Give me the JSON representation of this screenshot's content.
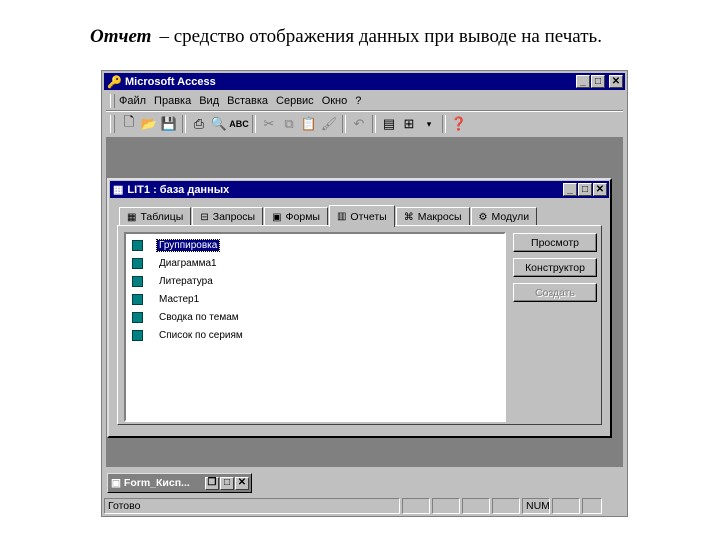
{
  "caption": {
    "term": "Отчет",
    "definition": "– средство отображения данных при выводе на печать."
  },
  "app": {
    "title": "Microsoft Access",
    "menu": [
      "Файл",
      "Правка",
      "Вид",
      "Вставка",
      "Сервис",
      "Окно",
      "?"
    ],
    "toolbar_icons": [
      "new-icon",
      "open-icon",
      "save-icon",
      "print-icon",
      "print-preview-icon",
      "spelling-icon",
      "cut-icon",
      "copy-icon",
      "paste-icon",
      "format-painter-icon",
      "undo-icon",
      "properties-icon",
      "relationships-icon",
      "new-object-icon",
      "help-icon"
    ]
  },
  "db_window": {
    "title": "LIT1 : база данных",
    "tabs": [
      {
        "label": "Таблицы",
        "icon": "table-icon"
      },
      {
        "label": "Запросы",
        "icon": "query-icon"
      },
      {
        "label": "Формы",
        "icon": "form-icon"
      },
      {
        "label": "Отчеты",
        "icon": "report-icon",
        "active": true
      },
      {
        "label": "Макросы",
        "icon": "macro-icon"
      },
      {
        "label": "Модули",
        "icon": "module-icon"
      }
    ],
    "reports": [
      "Группировка",
      "Диаграмма1",
      "Литература",
      "Мастер1",
      "Сводка по темам",
      "Список по сериям"
    ],
    "selected_index": 0,
    "buttons": {
      "preview": "Просмотр",
      "design": "Конструктор",
      "create": "Создать"
    }
  },
  "minimized_window": {
    "title": "Form_Кисп..."
  },
  "status": {
    "text": "Готово",
    "num": "NUM"
  }
}
